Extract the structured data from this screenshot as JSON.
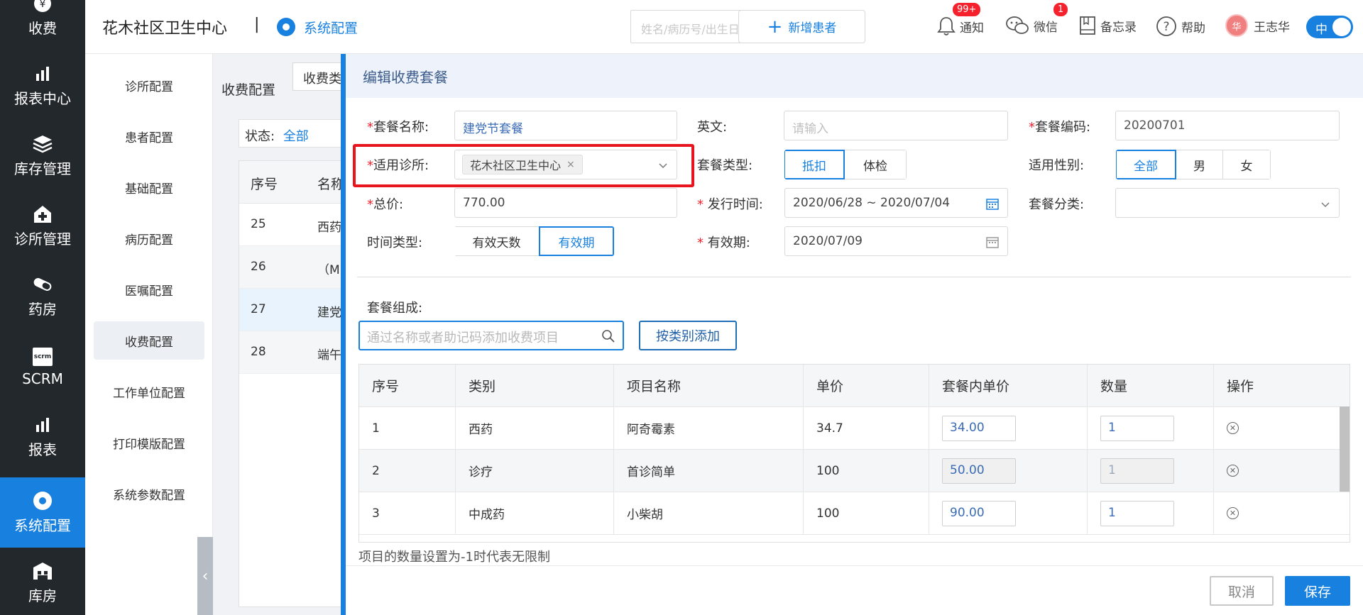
{
  "leftnav": {
    "items": [
      {
        "label": "收费",
        "icon": "yen-icon"
      },
      {
        "label": "报表中心",
        "icon": "bar-chart-icon"
      },
      {
        "label": "库存管理",
        "icon": "layers-icon"
      },
      {
        "label": "诊所管理",
        "icon": "medical-house-icon"
      },
      {
        "label": "药房",
        "icon": "pill-icon"
      },
      {
        "label": "SCRM",
        "icon": "scrm-icon",
        "icon_text": "scrm"
      },
      {
        "label": "报表",
        "icon": "bar-chart-icon"
      },
      {
        "label": "系统配置",
        "icon": "gear-icon"
      },
      {
        "label": "库房",
        "icon": "warehouse-icon"
      }
    ],
    "active_index": 7
  },
  "topbar": {
    "clinic_name": "花木社区卫生中心",
    "separator": "|",
    "section_title": "系统配置",
    "search_placeholder": "姓名/病历号/出生日期/拼",
    "add_patient_label": "新增患者",
    "notify_label": "通知",
    "notify_badge": "99+",
    "wechat_label": "微信",
    "wechat_badge": "1",
    "memo_label": "备忘录",
    "help_label": "帮助",
    "avatar_text": "华",
    "user_name": "王志华",
    "lang_toggle": "中"
  },
  "config_sidebar": {
    "items": [
      "诊所配置",
      "患者配置",
      "基础配置",
      "病历配置",
      "医嘱配置",
      "收费配置",
      "工作单位配置",
      "打印模版配置",
      "系统参数配置"
    ],
    "active_index": 5
  },
  "behind": {
    "title": "收费配置",
    "tab_partial": "收费类",
    "status_label": "状态:",
    "status_value": "全部",
    "columns": [
      "序号",
      "名称"
    ],
    "rows": [
      {
        "no": "25",
        "name": "西药"
      },
      {
        "no": "26",
        "name": "（M"
      },
      {
        "no": "27",
        "name": "建党"
      },
      {
        "no": "28",
        "name": "端午"
      }
    ]
  },
  "modal": {
    "title": "编辑收费套餐",
    "fields": {
      "package_name_label": "套餐名称:",
      "package_name_value": "建党节套餐",
      "english_label": "英文:",
      "english_placeholder": "请输入",
      "code_label": "套餐编码:",
      "code_value": "20200701",
      "clinic_label": "适用诊所:",
      "clinic_tag": "花木社区卫生中心",
      "type_label": "套餐类型:",
      "type_options": [
        "抵扣",
        "体检"
      ],
      "type_selected": 0,
      "gender_label": "适用性别:",
      "gender_options": [
        "全部",
        "男",
        "女"
      ],
      "gender_selected": 0,
      "total_label": "总价:",
      "total_value": "770.00",
      "issue_label": "发行时间:",
      "issue_value": "2020/06/28 ~ 2020/07/04",
      "category_label": "套餐分类:",
      "category_value": "",
      "time_type_label": "时间类型:",
      "time_type_options": [
        "有效天数",
        "有效期"
      ],
      "time_type_selected": 1,
      "valid_label": "有效期:",
      "valid_value": "2020/07/09"
    },
    "composition_label": "套餐组成:",
    "add_search_placeholder": "通过名称或者助记码添加收费项目",
    "add_by_category_label": "按类别添加",
    "table": {
      "columns": [
        "序号",
        "类别",
        "项目名称",
        "单价",
        "套餐内单价",
        "数量",
        "操作"
      ],
      "rows": [
        {
          "no": "1",
          "category": "西药",
          "name": "阿奇霉素",
          "price": "34.7",
          "package_price": "34.00",
          "qty": "1",
          "disabled": false
        },
        {
          "no": "2",
          "category": "诊疗",
          "name": "首诊简单",
          "price": "100",
          "package_price": "50.00",
          "qty": "1",
          "disabled": true
        },
        {
          "no": "3",
          "category": "中成药",
          "name": "小柴胡",
          "price": "100",
          "package_price": "90.00",
          "qty": "1",
          "disabled": false
        }
      ]
    },
    "note": "项目的数量设置为-1时代表无限制",
    "cancel_label": "取消",
    "save_label": "保存"
  },
  "colors": {
    "accent": "#1880df",
    "nav_bg": "#23282d",
    "highlight": "#e8141e"
  }
}
